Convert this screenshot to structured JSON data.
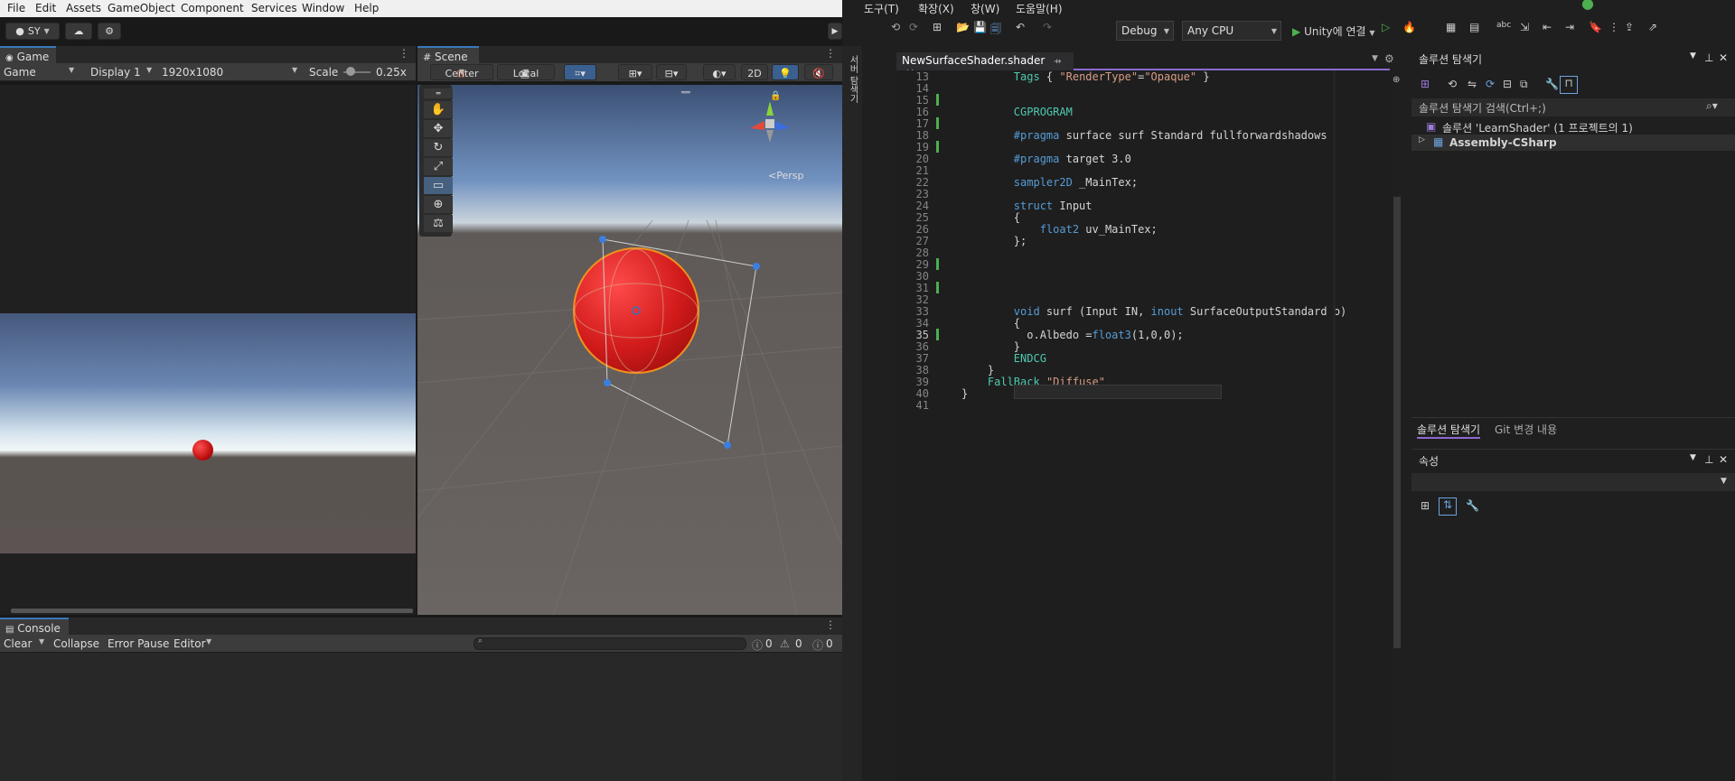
{
  "unity": {
    "menu": [
      "File",
      "Edit",
      "Assets",
      "GameObject",
      "Component",
      "Services",
      "Window",
      "Help"
    ],
    "account": "SY",
    "game_tab": "Game",
    "game_mode": "Game",
    "display": "Display 1",
    "resolution": "1920x1080",
    "scale_label": "Scale",
    "scale_value": "0.25x",
    "scene_tab": "Scene",
    "pivot": "Center",
    "space": "Local",
    "mode_2d": "2D",
    "persp_label": "<Persp",
    "console_tab": "Console",
    "console_clear": "Clear",
    "console_collapse": "Collapse",
    "console_error_pause": "Error Pause",
    "console_editor": "Editor",
    "count_log": "0",
    "count_warn": "0",
    "count_error": "0"
  },
  "vs": {
    "menu": [
      "도구(T)",
      "확장(X)",
      "창(W)",
      "도움말(H)"
    ],
    "config": "Debug",
    "platform": "Any CPU",
    "attach": "Unity에 연결",
    "file_tab": "NewSurfaceShader.shader",
    "side_label": "서버 탐색기",
    "code_lines": [
      {
        "n": "13",
        "html": "        <span class='ty'>Tags</span> { <span class='st'>\"RenderType\"</span>=<span class='st'>\"Opaque\"</span> }"
      },
      {
        "n": "14",
        "html": ""
      },
      {
        "n": "15",
        "html": ""
      },
      {
        "n": "16",
        "html": "        <span class='ty'>CGPROGRAM</span>"
      },
      {
        "n": "17",
        "html": ""
      },
      {
        "n": "18",
        "html": "        <span class='kw'>#pragma</span> surface surf Standard fullforwardshadows"
      },
      {
        "n": "19",
        "html": ""
      },
      {
        "n": "20",
        "html": "        <span class='kw'>#pragma</span> target 3.0"
      },
      {
        "n": "21",
        "html": ""
      },
      {
        "n": "22",
        "html": "        <span class='kw'>sampler2D</span> _MainTex;"
      },
      {
        "n": "23",
        "html": ""
      },
      {
        "n": "24",
        "html": "        <span class='kw'>struct</span> Input"
      },
      {
        "n": "25",
        "html": "        {"
      },
      {
        "n": "26",
        "html": "            <span class='kw'>float2</span> uv_MainTex;"
      },
      {
        "n": "27",
        "html": "        };"
      },
      {
        "n": "28",
        "html": ""
      },
      {
        "n": "29",
        "html": ""
      },
      {
        "n": "30",
        "html": ""
      },
      {
        "n": "31",
        "html": ""
      },
      {
        "n": "32",
        "html": ""
      },
      {
        "n": "33",
        "html": "        <span class='kw'>void</span> surf (Input IN, <span class='kw'>inout</span> SurfaceOutputStandard o)"
      },
      {
        "n": "34",
        "html": "        {"
      },
      {
        "n": "35",
        "html": "          o.Albedo =<span class='kw'>float3</span>(1,0,0);"
      },
      {
        "n": "36",
        "html": "        }"
      },
      {
        "n": "37",
        "html": "        <span class='ty'>ENDCG</span>"
      },
      {
        "n": "38",
        "html": "    }"
      },
      {
        "n": "39",
        "html": "    <span class='ty'>FallBack</span> <span class='st'>\"Diffuse\"</span>"
      },
      {
        "n": "40",
        "html": "}"
      },
      {
        "n": "41",
        "html": ""
      }
    ],
    "solution_explorer_title": "솔루션 탐색기",
    "solution_search": "솔루션 탐색기 검색(Ctrl+;)",
    "solution_item": "솔루션 'LearnShader' (1 프로젝트의 1)",
    "project_item": "Assembly-CSharp",
    "tab_solution": "솔루션 탐색기",
    "tab_git": "Git 변경 내용",
    "properties_title": "속성"
  }
}
